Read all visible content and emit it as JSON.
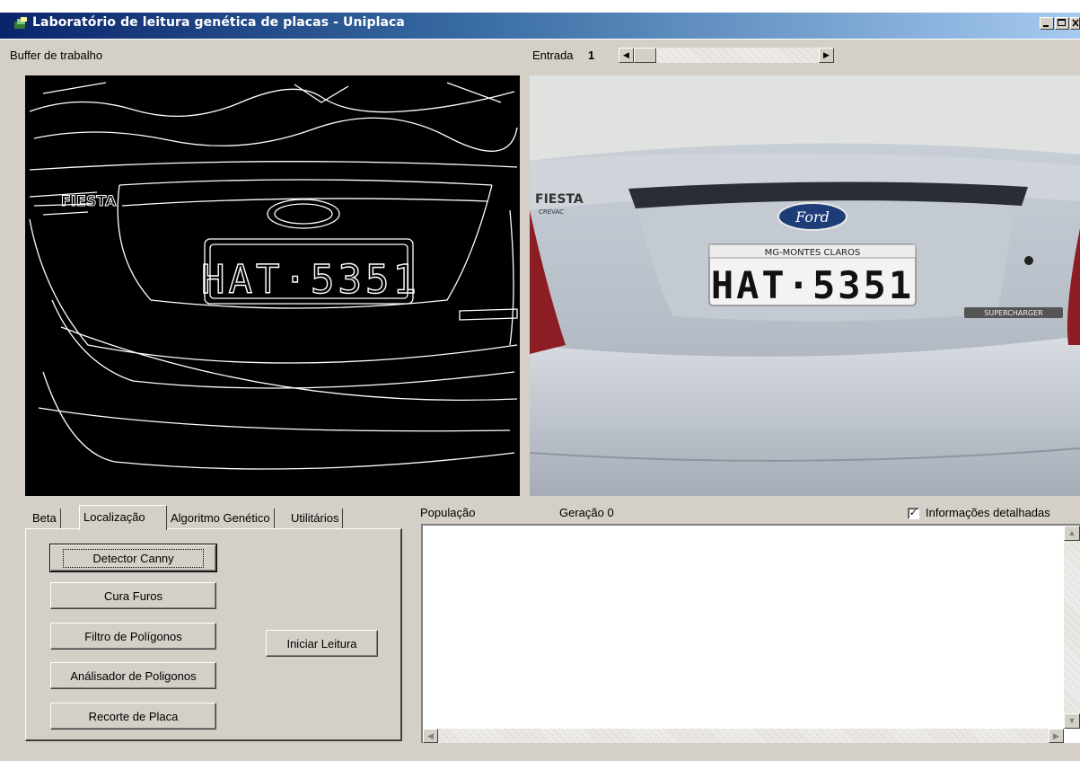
{
  "window": {
    "title": "Laboratório de leitura genética de placas - Uniplaca",
    "icon": "app-icon"
  },
  "buffer": {
    "label": "Buffer de trabalho"
  },
  "input": {
    "label": "Entrada",
    "value": "1"
  },
  "plates": {
    "edge_text": "HAT·5351",
    "photo_text": "HAT·5351",
    "city": "MG-MONTES CLAROS",
    "car_model": "FIESTA",
    "car_sub": "CREVAC",
    "badge": "SUPERCHARGER",
    "brand": "Ford"
  },
  "tabs": [
    {
      "label": "Beta"
    },
    {
      "label": "Localização"
    },
    {
      "label": "Algoritmo Genético"
    },
    {
      "label": "Utilitários"
    }
  ],
  "buttons": {
    "canny": "Detector Canny",
    "cura": "Cura Furos",
    "filtro": "Filtro de Polígonos",
    "analisador": "Análisador de Poligonos",
    "recorte": "Recorte de Placa",
    "iniciar": "Iniciar Leitura"
  },
  "population": {
    "label": "População",
    "generation": "Geração 0"
  },
  "details": {
    "label": "Informações detalhadas",
    "checked": true
  },
  "colors": {
    "titlebar_start": "#0a246a",
    "titlebar_end": "#a6caf0",
    "face": "#d4d0c8"
  }
}
